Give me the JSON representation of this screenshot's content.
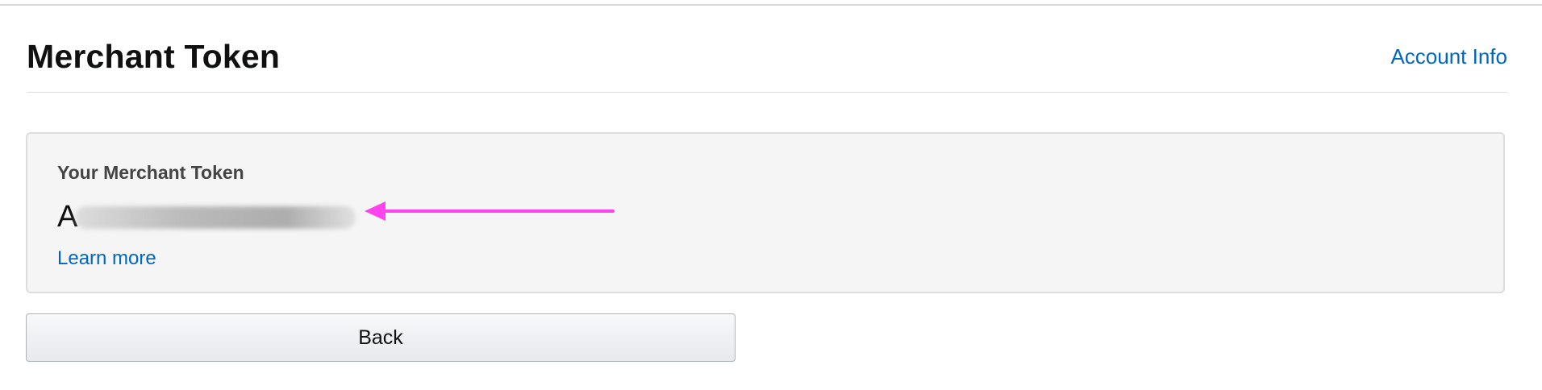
{
  "header": {
    "title": "Merchant Token",
    "account_link": "Account Info"
  },
  "token_section": {
    "label": "Your Merchant Token",
    "value_visible_prefix": "A",
    "learn_more": "Learn more"
  },
  "actions": {
    "back_label": "Back"
  },
  "colors": {
    "link": "#0066c0",
    "annotation_arrow": "#ff44ee",
    "box_background": "#f5f5f5"
  },
  "icons": {
    "annotation": "left-arrow-icon"
  }
}
